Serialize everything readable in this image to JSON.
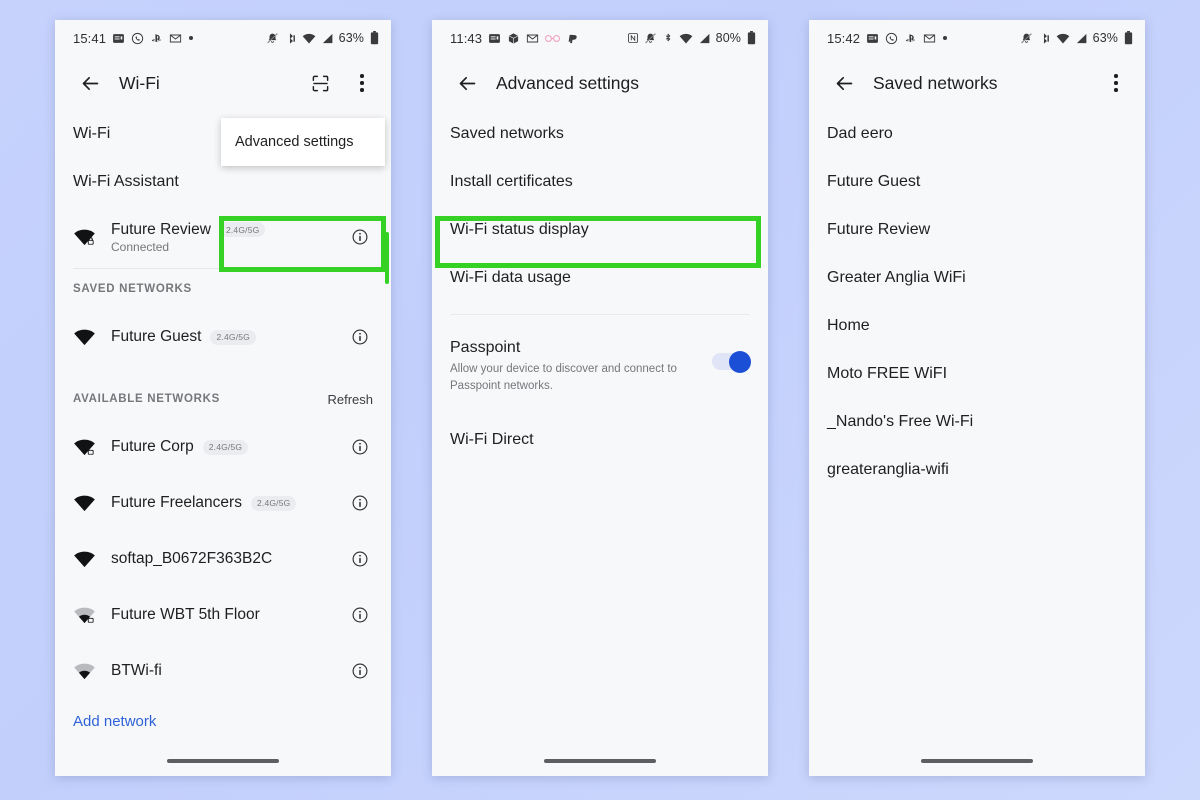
{
  "background_color": "#c4d0fb",
  "highlight_color": "#35d225",
  "link_color": "#2f62d8",
  "toggle_on_color": "#1a4fd6",
  "panels": [
    {
      "id": "wifi-screen",
      "statusbar": {
        "time": "15:41",
        "left_icons": [
          "news-icon",
          "whatsapp-icon",
          "playstation-icon",
          "gmail-icon",
          "dot-icon"
        ],
        "right_icons": [
          "bell-off-icon",
          "bluetooth-icon",
          "wifi-icon",
          "cell-signal-icon"
        ],
        "battery_percent": "63%",
        "battery_icon": "battery-icon"
      },
      "actionbar": {
        "back_icon": "back-arrow-icon",
        "title": "Wi-Fi",
        "actions": [
          "qr-scan-icon",
          "overflow-menu-icon"
        ]
      },
      "rows": [
        {
          "label": "Wi-Fi"
        },
        {
          "label": "Wi-Fi Assistant"
        }
      ],
      "connected_network": {
        "name": "Future Review",
        "band": "2.4G/5G",
        "status": "Connected",
        "icon": "wifi-full-lock-icon",
        "info_icon": "info-icon"
      },
      "saved_section": {
        "title": "SAVED NETWORKS",
        "networks": [
          {
            "name": "Future Guest",
            "band": "2.4G/5G",
            "icon": "wifi-full-icon",
            "info_icon": "info-icon"
          }
        ]
      },
      "available_section": {
        "title": "AVAILABLE NETWORKS",
        "action": "Refresh",
        "networks": [
          {
            "name": "Future Corp",
            "band": "2.4G/5G",
            "icon": "wifi-full-lock-icon",
            "info_icon": "info-icon"
          },
          {
            "name": "Future Freelancers",
            "band": "2.4G/5G",
            "icon": "wifi-full-icon",
            "info_icon": "info-icon"
          },
          {
            "name": "softap_B0672F363B2C",
            "band": "",
            "icon": "wifi-full-icon",
            "info_icon": "info-icon"
          },
          {
            "name": "Future WBT 5th Floor",
            "band": "",
            "icon": "wifi-weak-lock-icon",
            "info_icon": "info-icon"
          },
          {
            "name": "BTWi-fi",
            "band": "",
            "icon": "wifi-weak-icon",
            "info_icon": "info-icon"
          }
        ]
      },
      "add_network": "Add network",
      "popup_menu": {
        "items": [
          "Advanced settings"
        ],
        "highlighted": "Advanced settings"
      }
    },
    {
      "id": "advanced-settings-screen",
      "statusbar": {
        "time": "11:43",
        "left_icons": [
          "news-icon",
          "package-icon",
          "gmail-icon",
          "glasses-icon",
          "paypal-icon"
        ],
        "right_icons": [
          "nfc-icon",
          "bell-off-icon",
          "bluetooth-icon",
          "wifi-icon",
          "cell-signal-icon"
        ],
        "battery_percent": "80%",
        "battery_icon": "battery-icon"
      },
      "actionbar": {
        "back_icon": "back-arrow-icon",
        "title": "Advanced settings",
        "actions": []
      },
      "items": [
        "Saved networks",
        "Install certificates",
        "Wi-Fi status display",
        "Wi-Fi data usage"
      ],
      "highlighted_item": "Saved networks",
      "passpoint": {
        "title": "Passpoint",
        "description": "Allow your device to discover and connect to Passpoint networks.",
        "toggle_on": true,
        "toggle_name": "passpoint-toggle"
      },
      "wifi_direct": "Wi-Fi Direct"
    },
    {
      "id": "saved-networks-screen",
      "statusbar": {
        "time": "15:42",
        "left_icons": [
          "news-icon",
          "whatsapp-icon",
          "playstation-icon",
          "gmail-icon",
          "dot-icon"
        ],
        "right_icons": [
          "bell-off-icon",
          "bluetooth-icon",
          "wifi-icon",
          "cell-signal-icon"
        ],
        "battery_percent": "63%",
        "battery_icon": "battery-icon"
      },
      "actionbar": {
        "back_icon": "back-arrow-icon",
        "title": "Saved networks",
        "actions": [
          "overflow-menu-icon"
        ]
      },
      "networks": [
        "Dad eero",
        "Future Guest",
        "Future Review",
        "Greater Anglia WiFi",
        "Home",
        "Moto FREE WiFI",
        "_Nando's Free Wi-Fi",
        "greateranglia-wifi"
      ]
    }
  ]
}
